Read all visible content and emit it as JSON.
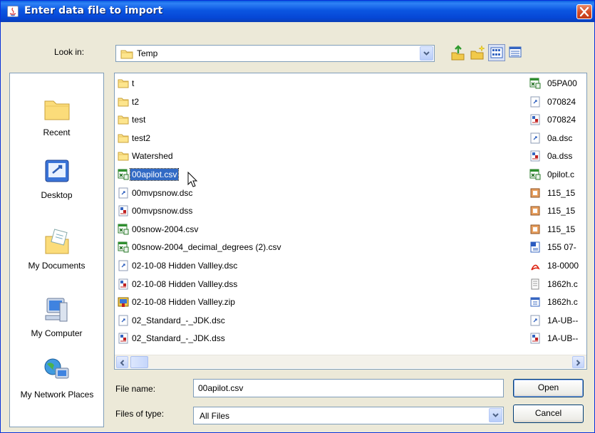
{
  "window": {
    "title": "Enter data file to import"
  },
  "lookin": {
    "label": "Look in:",
    "value": "Temp"
  },
  "places": [
    {
      "label": "Recent",
      "icon": "recent-folder-icon"
    },
    {
      "label": "Desktop",
      "icon": "desktop-icon"
    },
    {
      "label": "My Documents",
      "icon": "my-documents-icon"
    },
    {
      "label": "My Computer",
      "icon": "my-computer-icon"
    },
    {
      "label": "My Network Places",
      "icon": "network-places-icon"
    }
  ],
  "files_col1": [
    {
      "name": "t",
      "type": "folder"
    },
    {
      "name": "t2",
      "type": "folder"
    },
    {
      "name": "test",
      "type": "folder"
    },
    {
      "name": "test2",
      "type": "folder"
    },
    {
      "name": "Watershed",
      "type": "folder"
    },
    {
      "name": "00apilot.csv",
      "type": "csv",
      "selected": true
    },
    {
      "name": "00mvpsnow.dsc",
      "type": "dsc"
    },
    {
      "name": "00mvpsnow.dss",
      "type": "dss"
    },
    {
      "name": "00snow-2004.csv",
      "type": "csv"
    },
    {
      "name": "00snow-2004_decimal_degrees (2).csv",
      "type": "csv"
    },
    {
      "name": "02-10-08 Hidden Vallley.dsc",
      "type": "dsc"
    },
    {
      "name": "02-10-08 Hidden Vallley.dss",
      "type": "dss"
    },
    {
      "name": "02-10-08 Hidden Vallley.zip",
      "type": "zip"
    },
    {
      "name": "02_Standard_-_JDK.dsc",
      "type": "dsc"
    },
    {
      "name": "02_Standard_-_JDK.dss",
      "type": "dss"
    }
  ],
  "files_col2": [
    {
      "name": "05PA00",
      "type": "csv"
    },
    {
      "name": "070824",
      "type": "dsc"
    },
    {
      "name": "070824",
      "type": "dss"
    },
    {
      "name": "0a.dsc",
      "type": "dsc"
    },
    {
      "name": "0a.dss",
      "type": "dss"
    },
    {
      "name": "0pilot.c",
      "type": "csv"
    },
    {
      "name": "115_15",
      "type": "img"
    },
    {
      "name": "115_15",
      "type": "img"
    },
    {
      "name": "115_15",
      "type": "img"
    },
    {
      "name": "155 07-",
      "type": "word"
    },
    {
      "name": "18-0000",
      "type": "pdf"
    },
    {
      "name": "1862h.c",
      "type": "txt"
    },
    {
      "name": "1862h.c",
      "type": "cal"
    },
    {
      "name": "1A-UB--",
      "type": "dsc"
    },
    {
      "name": "1A-UB--",
      "type": "dss"
    }
  ],
  "filename": {
    "label": "File name:",
    "value": "00apilot.csv"
  },
  "filetype": {
    "label": "Files of type:",
    "value": "All Files"
  },
  "buttons": {
    "open": "Open",
    "cancel": "Cancel"
  },
  "colors": {
    "titlebar": "#0b56e1",
    "selection": "#316ac5",
    "dialog": "#ece9d8"
  }
}
